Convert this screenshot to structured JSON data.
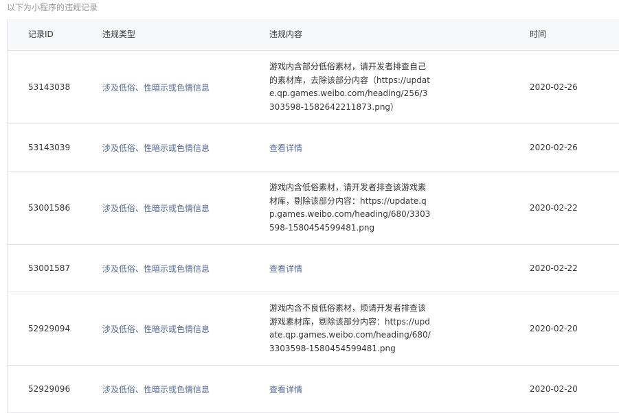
{
  "caption": "以下为小程序的违规记录",
  "columns": {
    "id": "记录ID",
    "type": "违规类型",
    "content": "违规内容",
    "time": "时间"
  },
  "rows": [
    {
      "id": "53143038",
      "type": "涉及低俗、性暗示或色情信息",
      "content": "游戏内含部分低俗素材，请开发者排查自己的素材库，去除该部分内容（https://update.qp.games.weibo.com/heading/256/3303598-1582642211873.png）",
      "time": "2020-02-26"
    },
    {
      "id": "53143039",
      "type": "涉及低俗、性暗示或色情信息",
      "content": "查看详情",
      "time": "2020-02-26"
    },
    {
      "id": "53001586",
      "type": "涉及低俗、性暗示或色情信息",
      "content": "游戏内含低俗素材，请开发者排查该游戏素材库，剔除该部分内容：https://update.qp.games.weibo.com/heading/680/3303598-1580454599481.png",
      "time": "2020-02-22"
    },
    {
      "id": "53001587",
      "type": "涉及低俗、性暗示或色情信息",
      "content": "查看详情",
      "time": "2020-02-22"
    },
    {
      "id": "52929094",
      "type": "涉及低俗、性暗示或色情信息",
      "content": "游戏内含不良低俗素材，烦请开发者排查该游戏素材库，剔除该部分内容：https://update.qp.games.weibo.com/heading/680/3303598-1580454599481.png",
      "time": "2020-02-20"
    },
    {
      "id": "52929096",
      "type": "涉及低俗、性暗示或色情信息",
      "content": "查看详情",
      "time": "2020-02-20"
    }
  ]
}
